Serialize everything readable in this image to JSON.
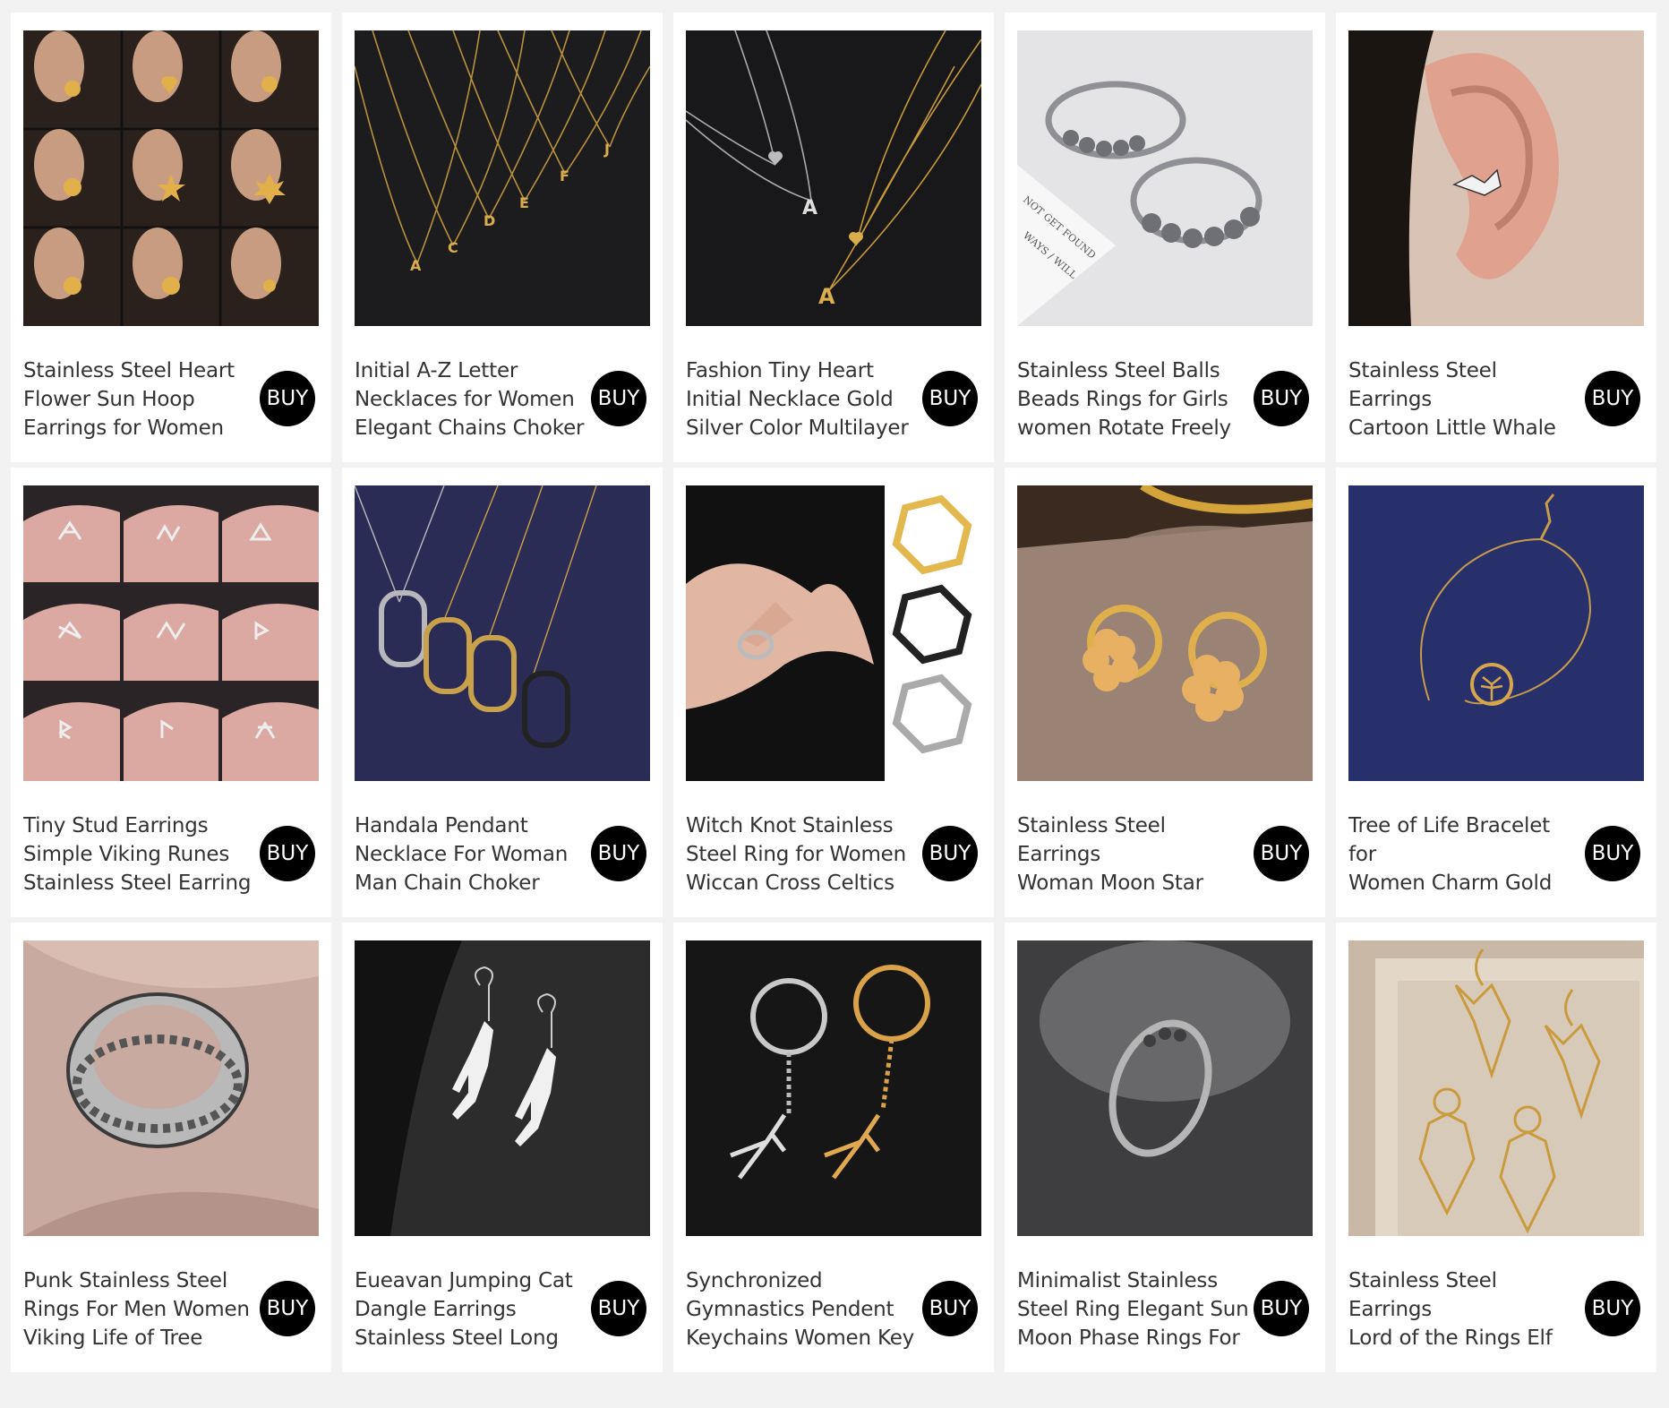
{
  "products": [
    {
      "title": "Stainless Steel Heart\nFlower Sun Hoop\nEarrings for Women",
      "buy": "BUY",
      "image": "earring-grid-photo",
      "bg": "#2a211c"
    },
    {
      "title": "Initial A-Z Letter\nNecklaces for Women\nElegant Chains Choker",
      "buy": "BUY",
      "image": "letter-necklace-photo",
      "bg": "#1c1c1e"
    },
    {
      "title": "Fashion Tiny Heart\nInitial Necklace Gold\nSilver Color Multilayer",
      "buy": "BUY",
      "image": "heart-necklace-photo",
      "bg": "#18181a"
    },
    {
      "title": "Stainless Steel Balls\nBeads Rings for Girls\nwomen  Rotate Freely",
      "buy": "BUY",
      "image": "bead-ring-photo",
      "bg": "#e4e4e6"
    },
    {
      "title": "Stainless Steel Earrings\nCartoon Little Whale\nFashion Unusual Stud",
      "buy": "BUY",
      "image": "whale-stud-photo",
      "bg": "#d9c3b4"
    },
    {
      "title": "Tiny Stud Earrings\nSimple Viking Runes\nStainless Steel Earring",
      "buy": "BUY",
      "image": "rune-stud-grid-photo",
      "bg": "#d6a9a4"
    },
    {
      "title": "Handala Pendant\nNecklace For Woman\nMan Chain Choker",
      "buy": "BUY",
      "image": "handala-pendant-photo",
      "bg": "#2a2c55"
    },
    {
      "title": "Witch Knot Stainless\nSteel Ring for Women\nWiccan Cross Celtics",
      "buy": "BUY",
      "image": "witch-knot-ring-photo",
      "bg": "#111111"
    },
    {
      "title": "Stainless Steel Earrings\nWoman Moon Star\nFlower Pendants Hoop",
      "buy": "BUY",
      "image": "flower-hoop-photo",
      "bg": "#8c7668"
    },
    {
      "title": "Tree of Life Bracelet for\nWomen Charm Gold\nPlated Stainless Steel",
      "buy": "BUY",
      "image": "tree-bracelet-photo",
      "bg": "#27306a"
    },
    {
      "title": "Punk Stainless Steel\nRings For Men Women\nViking Life of Tree",
      "buy": "BUY",
      "image": "viking-ring-photo",
      "bg": "#c8aaa0"
    },
    {
      "title": "Eueavan Jumping Cat\nDangle Earrings\nStainless Steel Long",
      "buy": "BUY",
      "image": "cat-earring-photo",
      "bg": "#1f1f1f"
    },
    {
      "title": "Synchronized\nGymnastics Pendent\nKeychains Women Key",
      "buy": "BUY",
      "image": "gymnast-keychain-photo",
      "bg": "#161616"
    },
    {
      "title": "Minimalist Stainless\nSteel Ring Elegant Sun\nMoon Phase Rings For",
      "buy": "BUY",
      "image": "moon-ring-photo",
      "bg": "#3e3e40"
    },
    {
      "title": "Stainless Steel Earrings\nLord of the Rings Elf\nPrincess Pendant Hoop",
      "buy": "BUY",
      "image": "elf-earring-photo",
      "bg": "#c9b8a6"
    }
  ]
}
